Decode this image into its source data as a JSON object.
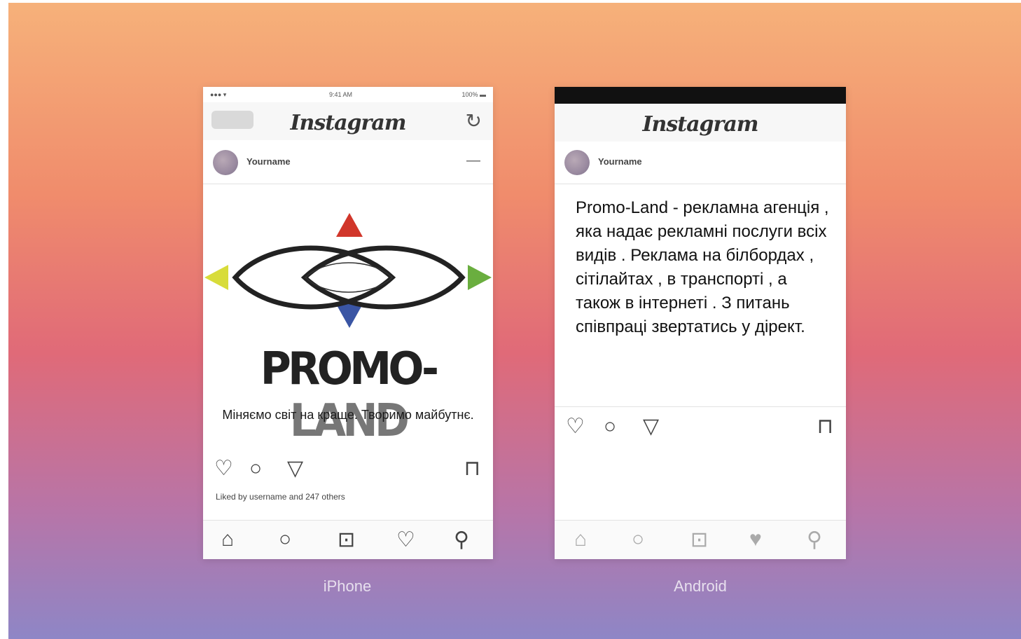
{
  "devices": {
    "iphone": {
      "label": "iPhone",
      "wordmark": "Instagram",
      "refresh_icon": "refresh-icon",
      "username": "Yourname",
      "post": {
        "brand_part1": "PROMO-",
        "brand_part2": "LAND",
        "tagline": "Міняємо світ на краще. Творимо майбутнє.",
        "colors": {
          "triangle_up": "#d1362a",
          "triangle_down": "#3a55a4",
          "triangle_left": "#d8dc3a",
          "triangle_right": "#6aae3f"
        }
      },
      "likes": "Liked by username and 247 others"
    },
    "android": {
      "label": "Android",
      "wordmark": "Instagram",
      "username": "Yourname",
      "caption": "Promo-Land - рекламна агенція , яка надає рекламні послуги всіх видів . Реклама на білбордах , сітілайтах , в транспорті , а також в інтернеті . З питань співпраці звертатись у дірект."
    }
  }
}
